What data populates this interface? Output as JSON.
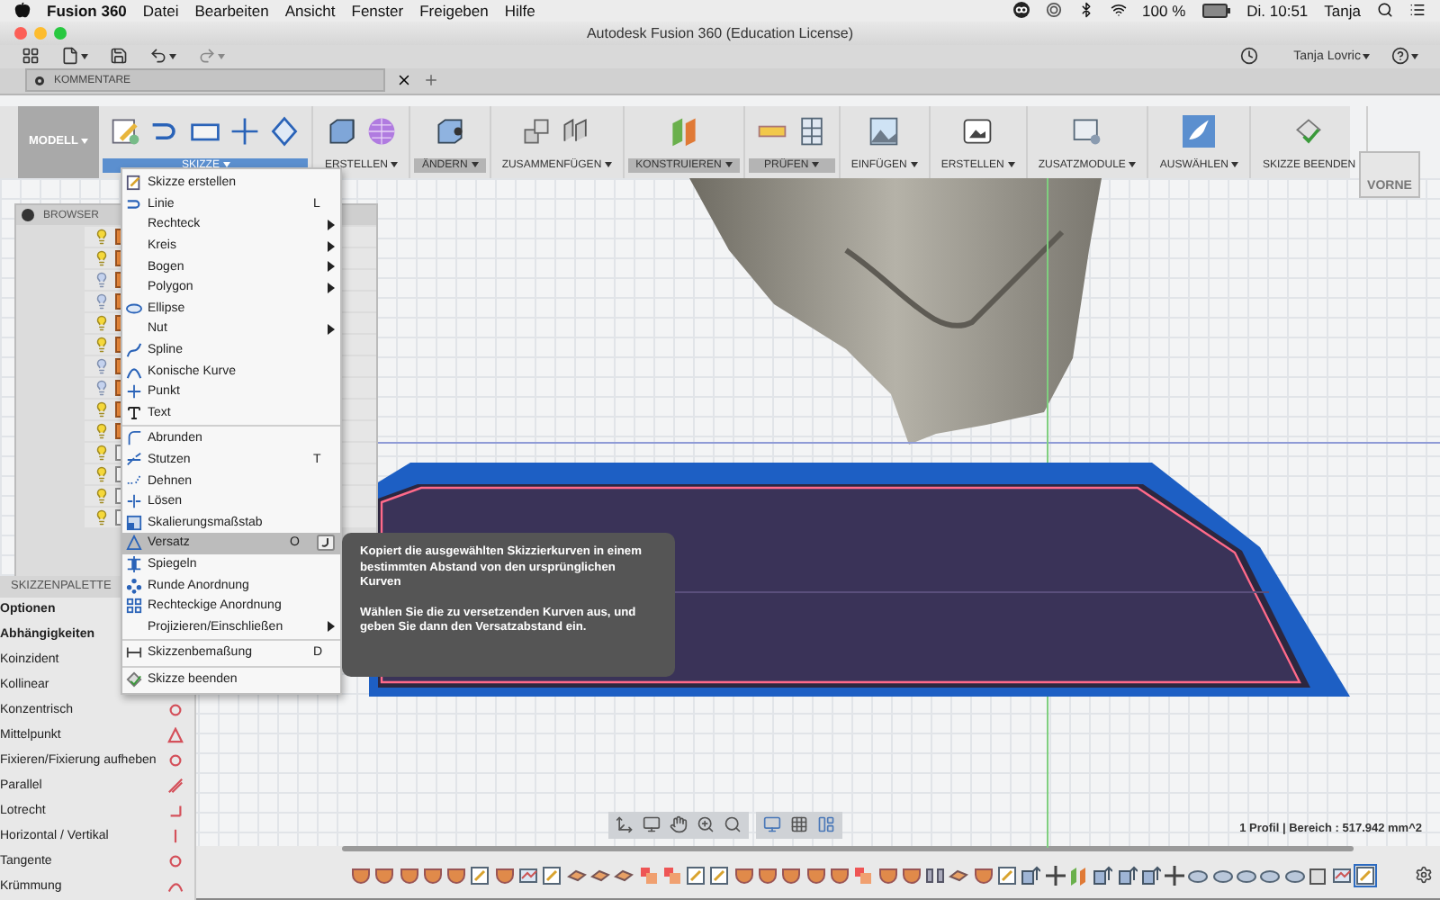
{
  "menubar": {
    "app": "Fusion 360",
    "items": [
      "Datei",
      "Bearbeiten",
      "Ansicht",
      "Fenster",
      "Freigeben",
      "Hilfe"
    ],
    "battery": "100 %",
    "clock": "Di. 10:51",
    "user": "Tanja"
  },
  "window": {
    "title": "Autodesk Fusion 360 (Education License)"
  },
  "toolbar": {
    "user": "Tanja Lovric"
  },
  "document_tab": {
    "label": "KOMMENTARE"
  },
  "ribbon": {
    "workspace": "MODELL",
    "groups": [
      {
        "label": "SKIZZE",
        "selected": true,
        "highlighted": false
      },
      {
        "label": "ERSTELLEN",
        "selected": false,
        "highlighted": false
      },
      {
        "label": "ÄNDERN",
        "selected": false,
        "highlighted": true
      },
      {
        "label": "ZUSAMMENFÜGEN",
        "selected": false,
        "highlighted": false
      },
      {
        "label": "KONSTRUIEREN",
        "selected": false,
        "highlighted": true
      },
      {
        "label": "PRÜFEN",
        "selected": false,
        "highlighted": true
      },
      {
        "label": "EINFÜGEN",
        "selected": false,
        "highlighted": false
      },
      {
        "label": "ERSTELLEN",
        "selected": false,
        "highlighted": false
      },
      {
        "label": "ZUSATZMODULE",
        "selected": false,
        "highlighted": false
      },
      {
        "label": "AUSWÄHLEN",
        "selected": false,
        "highlighted": false
      },
      {
        "label": "SKIZZE BEENDEN",
        "selected": false,
        "highlighted": false
      }
    ]
  },
  "viewcube": {
    "face": "VORNE"
  },
  "sketch_menu": {
    "groups": [
      [
        {
          "label": "Skizze erstellen",
          "submenu": false,
          "selected": false
        },
        {
          "label": "Linie",
          "shortcut": "L",
          "submenu": false,
          "selected": false
        },
        {
          "label": "Rechteck",
          "submenu": true,
          "selected": false
        },
        {
          "label": "Kreis",
          "submenu": true,
          "selected": false
        },
        {
          "label": "Bogen",
          "submenu": true,
          "selected": false
        },
        {
          "label": "Polygon",
          "submenu": true,
          "selected": false
        },
        {
          "label": "Ellipse",
          "submenu": false,
          "selected": false
        },
        {
          "label": "Nut",
          "submenu": true,
          "selected": false
        },
        {
          "label": "Spline",
          "submenu": false,
          "selected": false
        },
        {
          "label": "Konische Kurve",
          "submenu": false,
          "selected": false
        },
        {
          "label": "Punkt",
          "submenu": false,
          "selected": false
        },
        {
          "label": "Text",
          "submenu": false,
          "selected": false
        }
      ],
      [
        {
          "label": "Abrunden",
          "submenu": false,
          "selected": false
        },
        {
          "label": "Stutzen",
          "shortcut": "T",
          "submenu": false,
          "selected": false
        },
        {
          "label": "Dehnen",
          "submenu": false,
          "selected": false
        },
        {
          "label": "Lösen",
          "submenu": false,
          "selected": false
        },
        {
          "label": "Skalierungsmaßstab",
          "submenu": false,
          "selected": false
        },
        {
          "label": "Versatz",
          "shortcut": "O",
          "submenu": false,
          "selected": true
        },
        {
          "label": "Spiegeln",
          "submenu": false,
          "selected": false
        },
        {
          "label": "Runde Anordnung",
          "submenu": false,
          "selected": false
        },
        {
          "label": "Rechteckige Anordnung",
          "submenu": false,
          "selected": false
        },
        {
          "label": "Projizieren/Einschließen",
          "submenu": true,
          "selected": false
        }
      ],
      [
        {
          "label": "Skizzenbemaßung",
          "shortcut": "D",
          "submenu": false,
          "selected": false
        }
      ],
      [
        {
          "label": "Skizze beenden",
          "submenu": false,
          "selected": false
        }
      ]
    ]
  },
  "tooltip": {
    "paragraphs": [
      "Kopiert die ausgewählten Skizzierkurven in einem bestimmten Abstand von den ursprünglichen Kurven",
      "Wählen Sie die zu versetzenden Kurven aus, und geben Sie dann den Versatzabstand ein."
    ]
  },
  "browser": {
    "title": "BROWSER",
    "rows": [
      {
        "visible": true,
        "kind": "body"
      },
      {
        "visible": true,
        "kind": "body"
      },
      {
        "visible": false,
        "kind": "body"
      },
      {
        "visible": false,
        "kind": "body"
      },
      {
        "visible": true,
        "kind": "body"
      },
      {
        "visible": true,
        "kind": "body"
      },
      {
        "visible": false,
        "kind": "body"
      },
      {
        "visible": false,
        "kind": "body"
      },
      {
        "visible": true,
        "kind": "body"
      },
      {
        "visible": true,
        "kind": "body"
      },
      {
        "visible": true,
        "kind": "sketch"
      },
      {
        "visible": true,
        "kind": "sketch"
      },
      {
        "visible": true,
        "kind": "sketch"
      },
      {
        "visible": true,
        "kind": "sketch"
      }
    ]
  },
  "sketch_palette": {
    "title": "SKIZZENPALETTE",
    "sections": [
      "Optionen",
      "Abhängigkeiten"
    ],
    "constraints": [
      "Koinzident",
      "Kollinear",
      "Konzentrisch",
      "Mittelpunkt",
      "Fixieren/Fixierung aufheben",
      "Parallel",
      "Lotrecht",
      "Horizontal / Vertikal",
      "Tangente",
      "Krümmung"
    ]
  },
  "status": "1 Profil | Bereich : 517.942 mm^2",
  "timeline": {
    "steps": [
      {
        "kind": "fillet",
        "selected": false
      },
      {
        "kind": "fillet",
        "selected": false
      },
      {
        "kind": "fillet",
        "selected": false
      },
      {
        "kind": "fillet",
        "selected": false
      },
      {
        "kind": "fillet",
        "selected": false
      },
      {
        "kind": "sketch",
        "selected": false
      },
      {
        "kind": "fillet",
        "selected": false
      },
      {
        "kind": "graph",
        "selected": false
      },
      {
        "kind": "sketch",
        "selected": false
      },
      {
        "kind": "combine",
        "selected": false
      },
      {
        "kind": "combine",
        "selected": false
      },
      {
        "kind": "combine",
        "selected": false
      },
      {
        "kind": "split",
        "selected": false
      },
      {
        "kind": "split",
        "selected": false
      },
      {
        "kind": "sketch",
        "selected": false
      },
      {
        "kind": "sketch",
        "selected": false
      },
      {
        "kind": "fillet",
        "selected": false
      },
      {
        "kind": "fillet",
        "selected": false
      },
      {
        "kind": "fillet",
        "selected": false
      },
      {
        "kind": "fillet",
        "selected": false
      },
      {
        "kind": "fillet",
        "selected": false
      },
      {
        "kind": "split",
        "selected": false
      },
      {
        "kind": "fillet",
        "selected": false
      },
      {
        "kind": "fillet",
        "selected": false
      },
      {
        "kind": "mirror",
        "selected": false
      },
      {
        "kind": "combine",
        "selected": false
      },
      {
        "kind": "fillet",
        "selected": false
      },
      {
        "kind": "sketch",
        "selected": false
      },
      {
        "kind": "extrude",
        "selected": false
      },
      {
        "kind": "move",
        "selected": false
      },
      {
        "kind": "plane",
        "selected": false
      },
      {
        "kind": "extrude",
        "selected": false
      },
      {
        "kind": "extrude",
        "selected": false
      },
      {
        "kind": "extrude",
        "selected": false
      },
      {
        "kind": "move",
        "selected": false
      },
      {
        "kind": "surface",
        "selected": false
      },
      {
        "kind": "surface",
        "selected": false
      },
      {
        "kind": "surface",
        "selected": false
      },
      {
        "kind": "surface",
        "selected": false
      },
      {
        "kind": "surface",
        "selected": false
      },
      {
        "kind": "body",
        "selected": false
      },
      {
        "kind": "graph",
        "selected": false
      },
      {
        "kind": "sketch",
        "selected": true
      }
    ]
  }
}
